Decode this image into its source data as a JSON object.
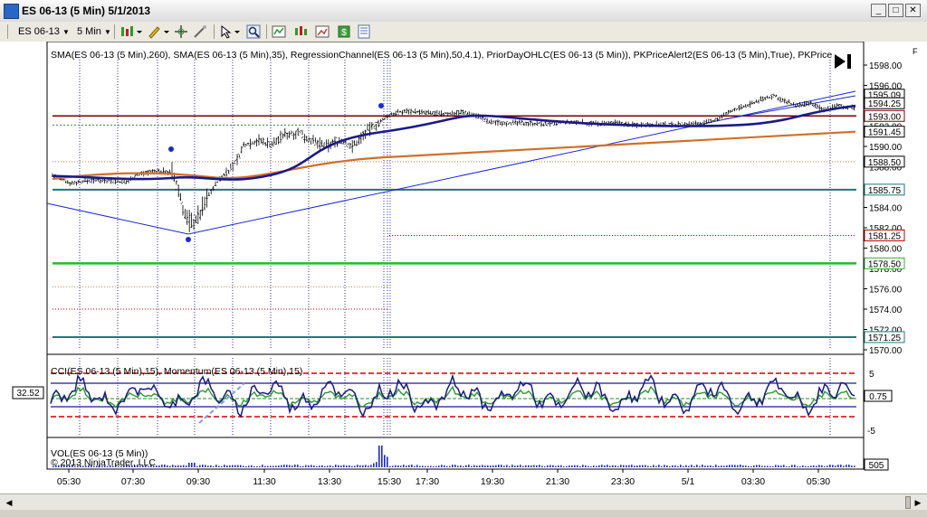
{
  "window": {
    "title": "ES 06-13 (5 Min)  5/1/2013",
    "minimize": "_",
    "maximize": "□",
    "close": "✕"
  },
  "toolbar": {
    "instrument": "ES 06-13",
    "interval": "5 Min",
    "icons": [
      "bar-style-icon",
      "draw-tool-icon",
      "crosshair-icon",
      "pointer-icon",
      "zoom-icon",
      "indicators-icon",
      "strategies-icon",
      "data-series-icon",
      "properties-icon"
    ]
  },
  "price_panel": {
    "indicator_label": "SMA(ES 06-13 (5 Min),260), SMA(ES 06-13 (5 Min),35), RegressionChannel(ES 06-13 (5 Min),50,4.1), PriorDayOHLC(ES 06-13 (5 Min)), PKPriceAlert2(ES 06-13 (5 Min),True), PKPrice",
    "corner_label": "F",
    "y_ticks": [
      "1598.00",
      "1596.00",
      "1592.00",
      "1590.00",
      "1588.00",
      "1586.00",
      "1584.00",
      "1582.00",
      "1580.00",
      "1578.00",
      "1576.00",
      "1574.00",
      "1572.00",
      "1570.00"
    ],
    "markers": [
      {
        "label": "1595.09",
        "color": "#000000"
      },
      {
        "label": "1594.25",
        "color": "#000000"
      },
      {
        "label": "1593.00",
        "color": "#7a0000"
      },
      {
        "label": "1591.45",
        "color": "#000000"
      },
      {
        "label": "1588.50",
        "color": "#000000"
      },
      {
        "label": "1585.75",
        "color": "#1a7a7a"
      },
      {
        "label": "1581.25",
        "color": "#c00000"
      },
      {
        "label": "1578.50",
        "color": "#2cb52c"
      },
      {
        "label": "1571.25",
        "color": "#1a7a7a"
      }
    ]
  },
  "cci_panel": {
    "label": "CCI(ES 06-13 (5 Min),15), Momentum(ES 06-13 (5 Min),15)",
    "left_value": "32.52",
    "y_ticks": [
      "5",
      "-5"
    ],
    "marker": "0.75"
  },
  "vol_panel": {
    "label": "VOL(ES 06-13 (5 Min))",
    "copyright": "© 2013 NinjaTrader, LLC",
    "marker": "505"
  },
  "x_axis": {
    "ticks": [
      "05:30",
      "07:30",
      "09:30",
      "11:30",
      "13:30",
      "15:30",
      "17:30",
      "19:30",
      "21:30",
      "23:30",
      "5/1",
      "03:30",
      "05:30"
    ]
  }
}
